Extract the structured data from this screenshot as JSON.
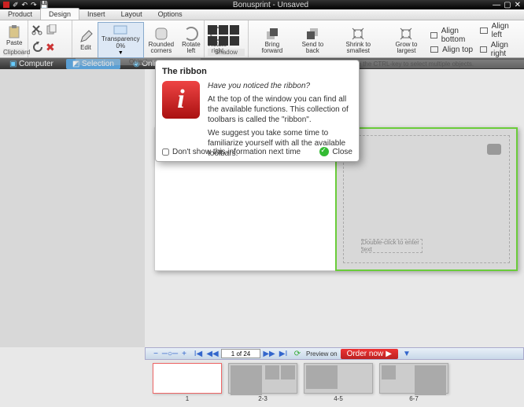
{
  "title": "Bonusprint - Unsaved",
  "tabs": [
    "Product",
    "Design",
    "Insert",
    "Layout",
    "Options"
  ],
  "ribbon": {
    "paste": "Paste",
    "clipboard": "Clipboard",
    "edit": "Edit",
    "transparency": "Transparency",
    "transparency_val": "0%",
    "rounded": "Rounded corners",
    "rotl": "Rotate left",
    "rotr": "Rotate right",
    "object": "Object",
    "shadow": "Shadow",
    "bring": "Bring forward",
    "send": "Send to back",
    "shrink": "Shrink to smallest",
    "grow": "Grow to largest",
    "ab": "Align bottom",
    "al": "Align left",
    "at": "Align top",
    "ar": "Align right",
    "possize": "Position and size. Use the CTRL-key to select multiple objects."
  },
  "subbar": {
    "computer": "Computer",
    "selection": "Selection",
    "online": "Online"
  },
  "page": {
    "dbl": "Double-click to enter text"
  },
  "nav": {
    "page": "1 of 24",
    "preview": "Preview on",
    "order": "Order now"
  },
  "thumbs": [
    "1",
    "2-3",
    "4-5",
    "6-7"
  ],
  "popup": {
    "title": "The ribbon",
    "l1": "Have you noticed the ribbon?",
    "l2": "At the top of the window you can find all the available functions. This collection of toolbars is called the \"ribbon\".",
    "l3": "We suggest you take some time to familiarize yourself with all the available toolbars.",
    "cb": "Don't show this information next time",
    "close": "Close"
  }
}
